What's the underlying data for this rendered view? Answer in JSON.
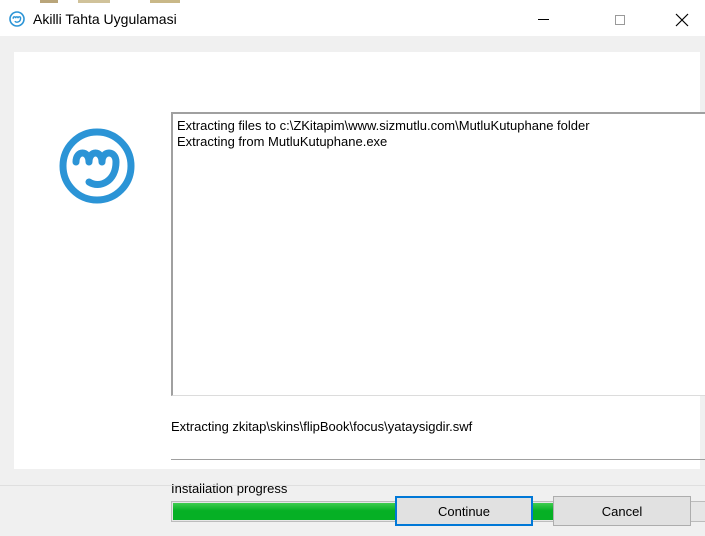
{
  "window": {
    "title": "Akilli Tahta Uygulamasi",
    "icon": "app-logo-icon",
    "controls": [
      "minimize-icon",
      "maximize-icon",
      "close-icon"
    ]
  },
  "log": {
    "lines": [
      "Extracting files to c:\\ZKitapim\\www.sizmutlu.com\\MutluKutuphane folder",
      "Extracting from MutluKutuphane.exe"
    ]
  },
  "status": {
    "current_file": "Extracting zkitap\\skins\\flipBook\\focus\\yataysigdir.swf"
  },
  "progress": {
    "label": "Installation progress",
    "fraction": 0.81
  },
  "buttons": {
    "continue": "Continue",
    "cancel": "Cancel"
  },
  "colors": {
    "brand": "#2b94d6",
    "progress": "#06b025",
    "focus_border": "#0078d7"
  }
}
